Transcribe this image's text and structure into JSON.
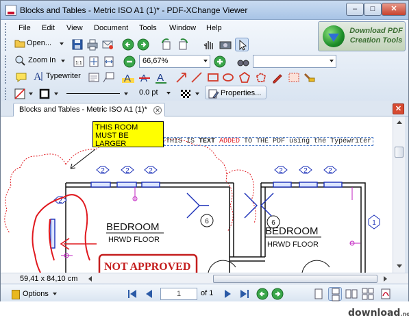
{
  "window": {
    "title": "Blocks and Tables - Metric ISO A1 (1)* - PDF-XChange Viewer",
    "min_glyph": "–",
    "max_glyph": "□",
    "close_glyph": "✕"
  },
  "menu": {
    "items": [
      "File",
      "Edit",
      "View",
      "Document",
      "Tools",
      "Window",
      "Help"
    ]
  },
  "toolbar": {
    "open_label": "Open...",
    "zoom_label": "Zoom In",
    "zoom_value": "66,67%",
    "typewriter_label": "Typewriter",
    "line_width_value": "0.0 pt",
    "properties_label": "Properties..."
  },
  "promo": {
    "text": "Download PDF Creation Tools"
  },
  "tab": {
    "label": "Blocks and Tables - Metric ISO A1 (1)*",
    "close_glyph": "✕"
  },
  "document": {
    "callout_text": "THIS ROOM MUST BE LARGER",
    "typewriter_prefix": "THIS IS ",
    "typewriter_bold": "TEXT",
    "typewriter_red": " ADDED",
    "typewriter_suffix": " TO THE PDF using the Typewriter",
    "room1_name": "BEDROOM",
    "room1_floor": "HRWD FLOOR",
    "room2_name": "BEDROOM",
    "room2_floor": "HRWD FLOOR",
    "stamp_text": "NOT APPROVED",
    "tags": [
      "2",
      "2",
      "2",
      "2",
      "2",
      "2",
      "2",
      "2",
      "6",
      "6",
      "1"
    ]
  },
  "status": {
    "coords": "59,41 x 84,10 cm"
  },
  "bottom": {
    "options_label": "Options",
    "page_value": "1",
    "page_of": "of 1"
  },
  "watermark": {
    "text": "download",
    "suffix": ".net.pl"
  },
  "colors": {
    "markup_red": "#e0191f",
    "callout_yellow": "#ffff00",
    "stamp_red": "#c41e1e",
    "tag_blue": "#1a2fb8",
    "dim_magenta": "#c020c0"
  }
}
